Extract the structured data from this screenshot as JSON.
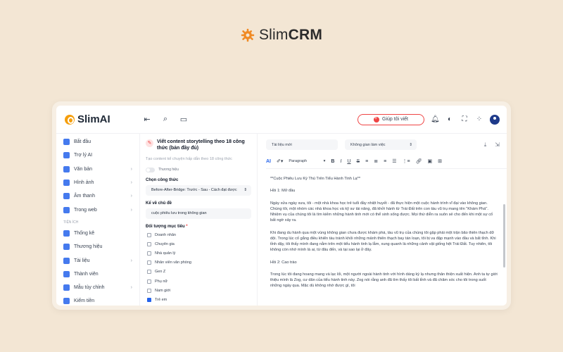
{
  "brand": {
    "prefix": "Slim",
    "bold": "CRM"
  },
  "app": {
    "logo_text": "SlimAI"
  },
  "topbar": {
    "help_button": "Giúp tôi viết"
  },
  "sidebar": {
    "items": [
      {
        "label": "Bắt đầu",
        "icon": "rocket-icon",
        "color": "#2563eb",
        "chevron": false
      },
      {
        "label": "Trợ lý AI",
        "icon": "robot-icon",
        "color": "#2563eb",
        "chevron": false
      },
      {
        "label": "Văn bản",
        "icon": "document-icon",
        "color": "#2563eb",
        "chevron": true
      },
      {
        "label": "Hình ảnh",
        "icon": "image-icon",
        "color": "#2563eb",
        "chevron": true
      },
      {
        "label": "Âm thanh",
        "icon": "audio-icon",
        "color": "#2563eb",
        "chevron": true
      },
      {
        "label": "Trong web",
        "icon": "globe-icon",
        "color": "#2563eb",
        "chevron": true
      }
    ],
    "section_label": "TIỆN ÍCH",
    "utilities": [
      {
        "label": "Thống kê",
        "icon": "stats-icon",
        "color": "#2563eb",
        "chevron": false
      },
      {
        "label": "Thương hiệu",
        "icon": "brand-icon",
        "color": "#2563eb",
        "chevron": false
      },
      {
        "label": "Tài liệu",
        "icon": "file-icon",
        "color": "#2563eb",
        "chevron": true
      },
      {
        "label": "Thành viên",
        "icon": "users-icon",
        "color": "#2563eb",
        "chevron": false
      },
      {
        "label": "Mẫu tùy chỉnh",
        "icon": "template-icon",
        "color": "#2563eb",
        "chevron": true
      },
      {
        "label": "Kiếm tiền",
        "icon": "money-icon",
        "color": "#2563eb",
        "chevron": false
      }
    ]
  },
  "config": {
    "title": "Viết content storytelling theo 18 công thức (bản đầy đủ)",
    "description": "Tạo content kể chuyện hấp dẫn theo 18 công thức",
    "toggle_label": "Thương hiệu",
    "formula_label": "Chọn công thức",
    "formula_value": "Before-After-Bridge: Trước - Sau - Cách đạt được",
    "topic_label": "Kể về chủ đề",
    "topic_value": "cuộc phiêu lưu trong không gian",
    "audience_label": "Đối tượng mục tiêu",
    "audience": [
      {
        "label": "Doanh nhân",
        "checked": false
      },
      {
        "label": "Chuyên gia",
        "checked": false
      },
      {
        "label": "Nhà quản lý",
        "checked": false
      },
      {
        "label": "Nhân viên văn phòng",
        "checked": false
      },
      {
        "label": "Gen Z",
        "checked": false
      },
      {
        "label": "Phụ nữ",
        "checked": false
      },
      {
        "label": "Nam giới",
        "checked": false
      },
      {
        "label": "Trẻ em",
        "checked": true
      }
    ]
  },
  "editor": {
    "doc_name": "Tài liệu mới",
    "workspace": "Không gian làm việc",
    "paragraph_style": "Paragraph",
    "content": [
      "**Cuộc Phiêu Lưu Kỳ Thú Trên Tiểu Hành Tinh Lạ**",
      "Hồi 1: Mở đầu",
      "Ngày xửa ngày xưa, tôi - một nhà khoa học trẻ tuổi đầy nhiệt huyết - đã thực hiện một cuộc hành trình vĩ đại vào không gian. Chúng tôi, một nhóm các nhà khoa học và kỹ sư tài năng, đã khởi hành từ Trái Đất trên con tàu vũ trụ mang tên \"Khám Phá\". Nhiệm vụ của chúng tôi là tìm kiếm những hành tinh mới có thể sinh sống được. Mọi thứ diễn ra suôn sẻ cho đến khi một sự cố bất ngờ xảy ra.",
      "Khi đang du hành qua một vùng không gian chưa được khám phá, tàu vũ trụ của chúng tôi gặp phải một trận bão thiên thạch dữ dội. Trong lúc cố gắng điều khiển tàu tránh khỏi những mảnh thiên thạch bay tán loạn, tôi bị va đập mạnh vào đầu và bất tỉnh. Khi tỉnh dậy, tôi thấy mình đang nằm trên một tiểu hành tinh lạ lẫm, xung quanh là những cảnh vật giống hệt Trái Đất. Tuy nhiên, tôi không còn nhớ mình là ai, từ đâu đến, và tại sao lại ở đây.",
      "Hồi 2: Cao trào",
      "Trong lúc tôi đang hoang mang và lạc lối, một người ngoài hành tinh với hình dáng kỳ lạ nhưng thân thiện xuất hiện. Anh ta tự giới thiệu mình là Zog, cư dân của tiểu hành tinh này. Zog nói rằng anh đã tìm thấy tôi bất tỉnh và đã chăm sóc cho tôi trong suốt những ngày qua. Mặc dù không nhớ được gì, tôi"
    ]
  }
}
